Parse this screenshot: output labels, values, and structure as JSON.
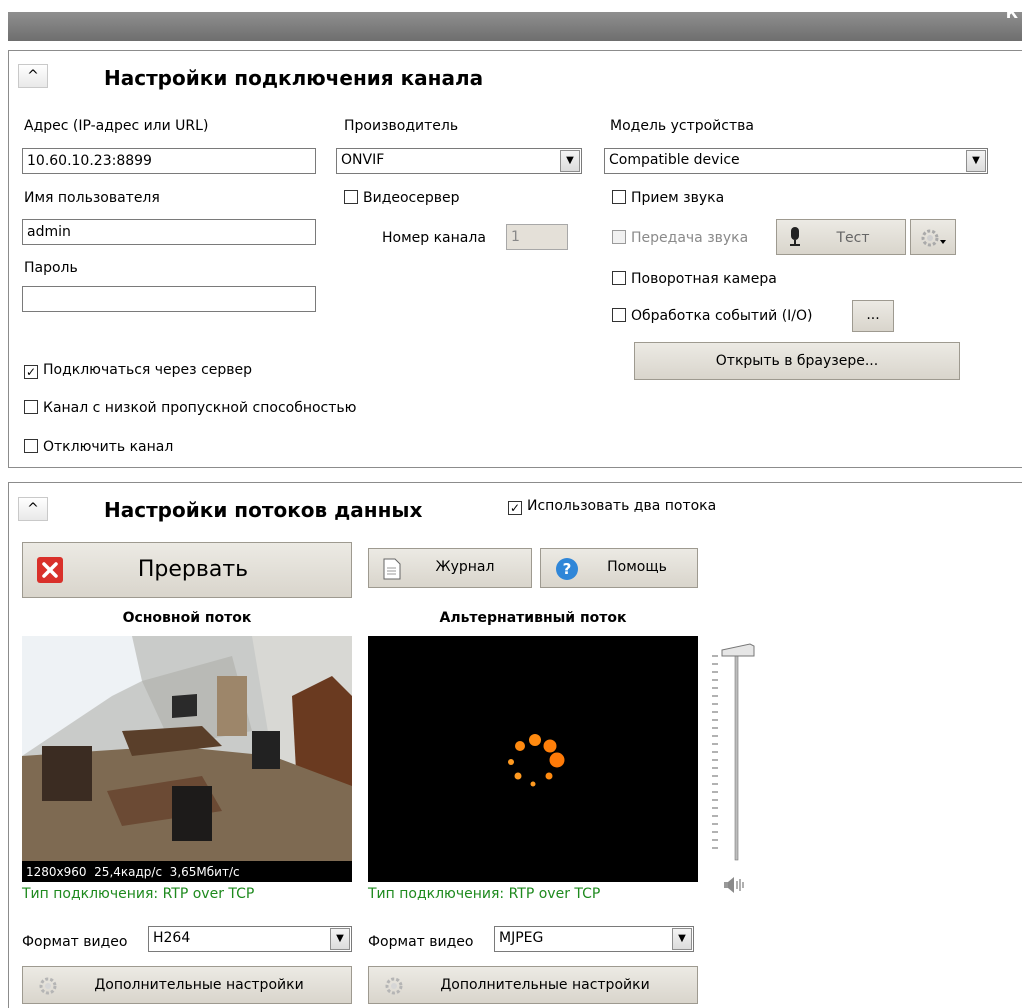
{
  "window": {
    "title_char": "К"
  },
  "connection": {
    "title": "Настройки подключения канала",
    "collapse": "^",
    "address_label": "Адрес (IP-адрес или URL)",
    "address_value": "10.60.10.23:8899",
    "username_label": "Имя пользователя",
    "username_value": "admin",
    "password_label": "Пароль",
    "password_value": "",
    "manufacturer_label": "Производитель",
    "manufacturer_value": "ONVIF",
    "videoserver_label": "Видеосервер",
    "channel_number_label": "Номер канала",
    "channel_number_value": "1",
    "model_label": "Модель устройства",
    "model_value": "Compatible device",
    "sound_receive_label": "Прием звука",
    "sound_transmit_label": "Передача звука",
    "test_label": "Тест",
    "ptz_label": "Поворотная камера",
    "events_label": "Обработка событий (I/O)",
    "events_more": "...",
    "open_browser_label": "Открыть в браузере...",
    "connect_via_server_label": "Подключаться через сервер",
    "connect_via_server_checked": "✓",
    "low_bandwidth_label": "Канал с низкой пропускной способностью",
    "disable_channel_label": "Отключить канал"
  },
  "streams": {
    "title": "Настройки потоков данных",
    "collapse": "^",
    "use_two_streams_label": "Использовать два потока",
    "use_two_streams_checked": "✓",
    "abort_label": "Прервать",
    "journal_label": "Журнал",
    "help_label": "Помощь",
    "main_title": "Основной поток",
    "alt_title": "Альтернативный поток",
    "main_overlay": "1280x960  25,4кадр/с  3,65Мбит/с",
    "connection_type_prefix": "Тип подключения:",
    "connection_type_value": "RTP over TCP",
    "video_format_label": "Формат видео",
    "main_format": "H264",
    "alt_format": "MJPEG",
    "advanced_label": "Дополнительные настройки",
    "volume_level": 0.96
  },
  "colors": {
    "accent_green": "#1e8a1e",
    "abort_red": "#d9302a",
    "spinner_orange": "#ff8a10"
  }
}
